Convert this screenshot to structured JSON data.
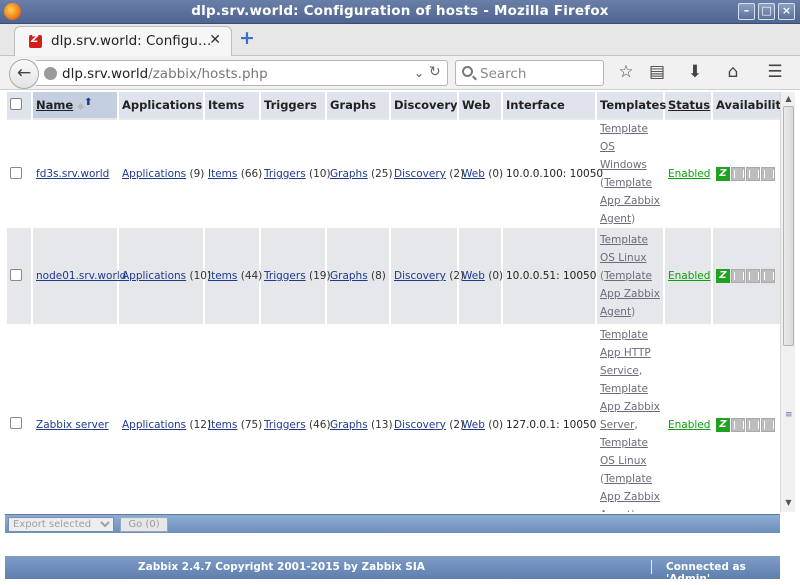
{
  "window": {
    "title": "dlp.srv.world: Configuration of hosts - Mozilla Firefox"
  },
  "tab": {
    "label": "dlp.srv.world: Configu…"
  },
  "nav": {
    "url_host": "dlp.srv.world",
    "url_path": "/zabbix/hosts.php",
    "search_placeholder": "Search"
  },
  "table": {
    "headers": {
      "name": "Name",
      "applications": "Applications",
      "items": "Items",
      "triggers": "Triggers",
      "graphs": "Graphs",
      "discovery": "Discovery",
      "web": "Web",
      "interface": "Interface",
      "templates": "Templates",
      "status": "Status",
      "availability": "Availability"
    },
    "rows": [
      {
        "name": "fd3s.srv.world",
        "applications": "Applications",
        "applications_count": "(9)",
        "items": "Items",
        "items_count": "(66)",
        "triggers": "Triggers",
        "triggers_count": "(10)",
        "graphs": "Graphs",
        "graphs_count": "(25)",
        "discovery": "Discovery",
        "discovery_count": "(2)",
        "web": "Web",
        "web_count": "(0)",
        "interface": "10.0.0.100: 10050",
        "templates": [
          {
            "name": "Template OS Windows",
            "children": [
              "Template App Zabbix Agent"
            ]
          }
        ],
        "status": "Enabled"
      },
      {
        "name": "node01.srv.world",
        "applications": "Applications",
        "applications_count": "(10)",
        "items": "Items",
        "items_count": "(44)",
        "triggers": "Triggers",
        "triggers_count": "(19)",
        "graphs": "Graphs",
        "graphs_count": "(8)",
        "discovery": "Discovery",
        "discovery_count": "(2)",
        "web": "Web",
        "web_count": "(0)",
        "interface": "10.0.0.51: 10050",
        "templates": [
          {
            "name": "Template OS Linux",
            "children": [
              "Template App Zabbix Agent"
            ]
          }
        ],
        "status": "Enabled"
      },
      {
        "name": "Zabbix server",
        "applications": "Applications",
        "applications_count": "(12)",
        "items": "Items",
        "items_count": "(75)",
        "triggers": "Triggers",
        "triggers_count": "(46)",
        "graphs": "Graphs",
        "graphs_count": "(13)",
        "discovery": "Discovery",
        "discovery_count": "(2)",
        "web": "Web",
        "web_count": "(0)",
        "interface": "127.0.0.1: 10050",
        "templates": [
          {
            "name": "Template App HTTP Service",
            "children": []
          },
          {
            "name": "Template App Zabbix Server",
            "children": []
          },
          {
            "name": "Template OS Linux",
            "children": [
              "Template App Zabbix Agent"
            ]
          }
        ],
        "status": "Enabled"
      }
    ]
  },
  "actions": {
    "select_label": "Export selected",
    "go_label": "Go (0)"
  },
  "footer": {
    "copyright": "Zabbix 2.4.7 Copyright 2001-2015 by Zabbix SIA",
    "connected": "Connected as 'Admin'"
  },
  "colors": {
    "enabled": "#0aa10a",
    "link": "#1f3a8d",
    "header_bar": "#6e8fbd",
    "zbx_available": "#1fa21f"
  }
}
